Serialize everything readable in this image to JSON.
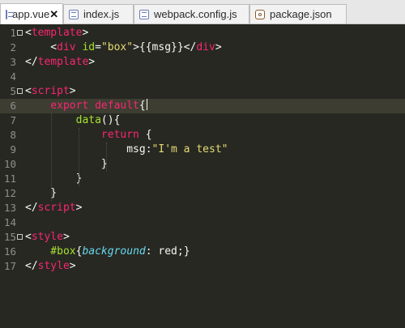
{
  "tabs": [
    {
      "label": "app.vue",
      "icon": "file-icon",
      "active": true
    },
    {
      "label": "index.js",
      "icon": "file-icon",
      "active": false
    },
    {
      "label": "webpack.config.js",
      "icon": "file-icon",
      "active": false
    },
    {
      "label": "package.json",
      "icon": "package-icon",
      "active": false
    }
  ],
  "close_symbol": "✕",
  "lines": [
    {
      "n": "1",
      "fold": true,
      "tokens": [
        [
          "t-punc",
          "<"
        ],
        [
          "t-tag",
          "template"
        ],
        [
          "t-punc",
          ">"
        ]
      ]
    },
    {
      "n": "2",
      "tokens": [
        [
          "t-punc",
          "    <"
        ],
        [
          "t-tag",
          "div"
        ],
        [
          "t-attr",
          " id"
        ],
        [
          "t-punc",
          "="
        ],
        [
          "t-str",
          "\"box\""
        ],
        [
          "t-punc",
          ">{{msg}}</"
        ],
        [
          "t-tag",
          "div"
        ],
        [
          "t-punc",
          ">"
        ]
      ]
    },
    {
      "n": "3",
      "tokens": [
        [
          "t-punc",
          "</"
        ],
        [
          "t-tag",
          "template"
        ],
        [
          "t-punc",
          ">"
        ]
      ]
    },
    {
      "n": "4",
      "tokens": []
    },
    {
      "n": "5",
      "fold": true,
      "tokens": [
        [
          "t-punc",
          "<"
        ],
        [
          "t-tag",
          "script"
        ],
        [
          "t-punc",
          ">"
        ]
      ]
    },
    {
      "n": "6",
      "current": true,
      "tokens": [
        [
          "t-kw",
          "    export default"
        ],
        [
          "t-punc",
          "{"
        ]
      ]
    },
    {
      "n": "7",
      "tokens": [
        [
          "t-fn",
          "        data"
        ],
        [
          "t-punc",
          "(){"
        ]
      ]
    },
    {
      "n": "8",
      "tokens": [
        [
          "t-kw",
          "            return"
        ],
        [
          "t-punc",
          " {"
        ]
      ]
    },
    {
      "n": "9",
      "tokens": [
        [
          "t-punc",
          "                msg:"
        ],
        [
          "t-str",
          "\"I'm a test\""
        ]
      ]
    },
    {
      "n": "10",
      "tokens": [
        [
          "t-punc",
          "            }"
        ]
      ]
    },
    {
      "n": "11",
      "tokens": [
        [
          "t-punc",
          "        }"
        ]
      ]
    },
    {
      "n": "12",
      "tokens": [
        [
          "t-punc",
          "    }"
        ]
      ]
    },
    {
      "n": "13",
      "tokens": [
        [
          "t-punc",
          "</"
        ],
        [
          "t-tag",
          "script"
        ],
        [
          "t-punc",
          ">"
        ]
      ]
    },
    {
      "n": "14",
      "tokens": []
    },
    {
      "n": "15",
      "fold": true,
      "tokens": [
        [
          "t-punc",
          "<"
        ],
        [
          "t-tag",
          "style"
        ],
        [
          "t-punc",
          ">"
        ]
      ]
    },
    {
      "n": "16",
      "tokens": [
        [
          "t-id",
          "    #box"
        ],
        [
          "t-punc",
          "{"
        ],
        [
          "t-prop",
          "background"
        ],
        [
          "t-punc",
          ": red;}"
        ]
      ]
    },
    {
      "n": "17",
      "tokens": [
        [
          "t-punc",
          "</"
        ],
        [
          "t-tag",
          "style"
        ],
        [
          "t-punc",
          ">"
        ]
      ]
    }
  ]
}
